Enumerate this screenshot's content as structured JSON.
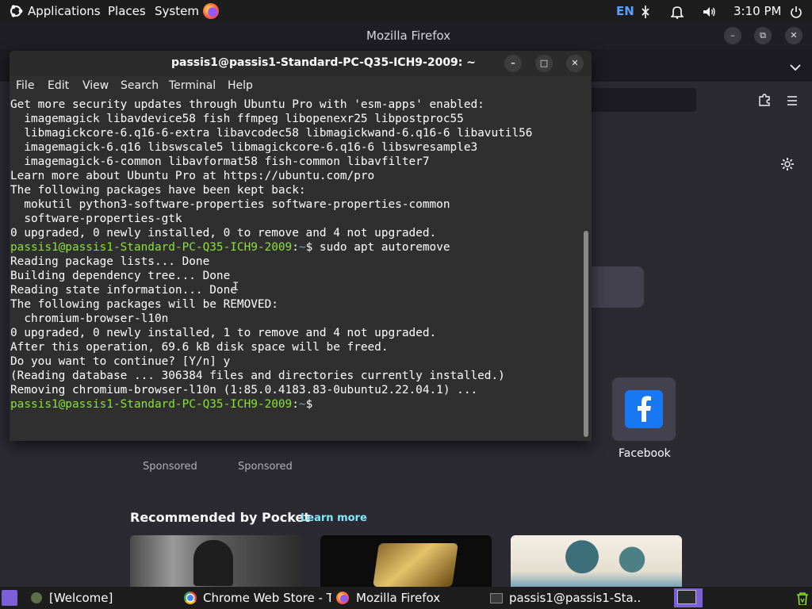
{
  "top_panel": {
    "menus": [
      "Applications",
      "Places",
      "System"
    ],
    "keyboard_layout": "EN",
    "clock": "3:10 PM"
  },
  "firefox": {
    "window_title": "Mozilla Firefox",
    "shortcut_label": "Facebook",
    "sponsored_labels": [
      "Sponsored",
      "Sponsored"
    ],
    "pocket_heading": "Recommended by Pocket",
    "pocket_link": "Learn more"
  },
  "terminal": {
    "title": "passis1@passis1-Standard-PC-Q35-ICH9-2009: ~",
    "menu": [
      "File",
      "Edit",
      "View",
      "Search",
      "Terminal",
      "Help"
    ],
    "prompt_user": "passis1@passis1-Standard-PC-Q35-ICH9-2009",
    "prompt_path": "~",
    "lines": [
      "Get more security updates through Ubuntu Pro with 'esm-apps' enabled:",
      "  imagemagick libavdevice58 fish ffmpeg libopenexr25 libpostproc55",
      "  libmagickcore-6.q16-6-extra libavcodec58 libmagickwand-6.q16-6 libavutil56",
      "  imagemagick-6.q16 libswscale5 libmagickcore-6.q16-6 libswresample3",
      "  imagemagick-6-common libavformat58 fish-common libavfilter7",
      "Learn more about Ubuntu Pro at https://ubuntu.com/pro",
      "The following packages have been kept back:",
      "  mokutil python3-software-properties software-properties-common",
      "  software-properties-gtk",
      "0 upgraded, 0 newly installed, 0 to remove and 4 not upgraded.",
      "sudo apt autoremove",
      "Reading package lists... Done",
      "Building dependency tree... Done",
      "Reading state information... Done",
      "The following packages will be REMOVED:",
      "  chromium-browser-l10n",
      "0 upgraded, 0 newly installed, 1 to remove and 4 not upgraded.",
      "After this operation, 69.6 kB disk space will be freed.",
      "Do you want to continue? [Y/n] y",
      "(Reading database ... 306384 files and directories currently installed.)",
      "Removing chromium-browser-l10n (1:85.0.4183.83-0ubuntu2.22.04.1) ...",
      ""
    ]
  },
  "taskbar": {
    "items": [
      "[Welcome]",
      "Chrome Web Store - T...",
      "Mozilla Firefox",
      "passis1@passis1-Sta..."
    ]
  },
  "icons": {
    "distro": "ubuntu-mate-logo-icon",
    "browser": "firefox-icon",
    "network": "network-icon",
    "notifications": "bell-icon",
    "volume": "speaker-icon",
    "power": "power-icon",
    "extensions": "puzzle-icon",
    "menu": "hamburger-icon",
    "settings": "gear-icon",
    "shortcut": "facebook-icon",
    "trash": "trash-icon"
  },
  "colors": {
    "prompt_user": "#8ae234",
    "prompt_path": "#729fcf",
    "firefox_bg": "#2b2a33",
    "pocket_link": "#80ebff",
    "facebook_blue": "#1877f2"
  }
}
